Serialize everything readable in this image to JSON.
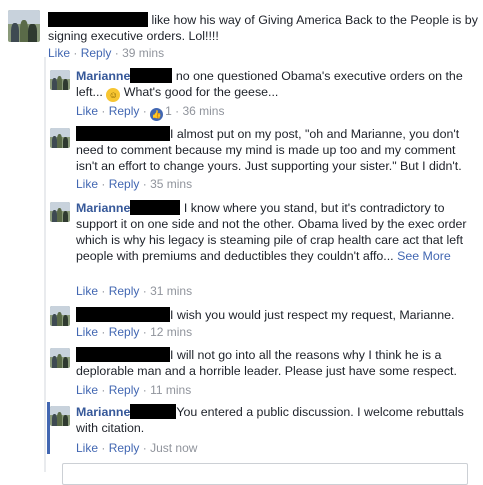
{
  "comments": [
    {
      "text": "like how his way of Giving America Back to the People is by signing executive orders. Lol!!!!",
      "like": "Like",
      "reply": "Reply",
      "time": "39 mins"
    },
    {
      "name": "Marianne",
      "text": "no one questioned Obama's executive orders on the left...",
      "text_after_emoji": "What's good for the geese...",
      "like": "Like",
      "reply": "Reply",
      "reaction_count": "1",
      "time": "36 mins"
    },
    {
      "text": "I almost put on my post, \"oh and Marianne, you don't need to comment because my mind is made up too and my comment isn't an effort to change yours. Just supporting your sister.\" But I didn't.",
      "like": "Like",
      "reply": "Reply",
      "time": "35 mins"
    },
    {
      "name": "Marianne",
      "text": "I know where you stand, but it's contradictory to support it on one side and not the other. Obama lived by the exec order which is why his legacy is steaming pile of crap health care act that left people with premiums and deductibles they couldn't affo...",
      "see_more": "See More",
      "like": "Like",
      "reply": "Reply",
      "time": "31 mins"
    },
    {
      "text": "I wish you would just respect my request, Marianne.",
      "like": "Like",
      "reply": "Reply",
      "time": "12 mins"
    },
    {
      "text": "I will not go into all the reasons why I think he is a deplorable man and a horrible leader. Please just have some respect.",
      "like": "Like",
      "reply": "Reply",
      "time": "11 mins"
    },
    {
      "name": "Marianne",
      "text": "You entered a public discussion. I welcome rebuttals with citation.",
      "like": "Like",
      "reply": "Reply",
      "time": "Just now"
    }
  ],
  "separator": "·",
  "colors": {
    "link": "#4267b2",
    "name": "#365899",
    "meta": "#90949c",
    "redaction": "#000000"
  },
  "icons": {
    "emoji": "smiling-face-icon",
    "reaction": "like-thumb-icon"
  }
}
